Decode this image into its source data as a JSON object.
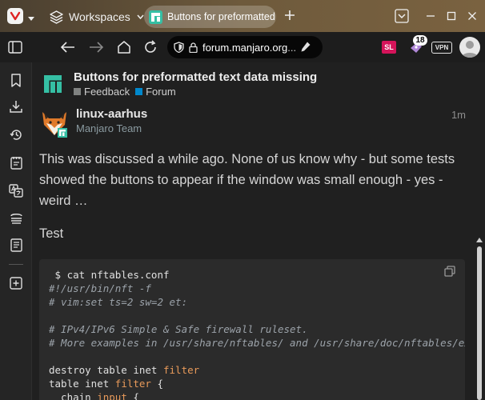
{
  "titlebar": {
    "workspaces_label": "Workspaces",
    "active_tab_title": "Buttons for preformatted text data missing",
    "new_tab_symbol": "+"
  },
  "addressbar": {
    "url_host": "forum.manjaro.org",
    "url_rest": "...",
    "extensions": {
      "sl_label": "SL",
      "badge_count": "18",
      "vpn_label": "VPN"
    }
  },
  "topic": {
    "title": "Buttons for preformatted text data missing",
    "categories": [
      {
        "name": "Feedback",
        "color": "#808281"
      },
      {
        "name": "Forum",
        "color": "#0088cc"
      }
    ]
  },
  "post": {
    "username": "linux-aarhus",
    "user_title": "Manjaro Team",
    "time": "1m",
    "paragraph": "This was discussed a while ago. None of us know why - but some tests showed the buttons to appear if the window was small enough - yes - weird …",
    "paragraph2": "Test",
    "code_lines": [
      {
        "text": " $ cat nftables.conf",
        "style": "plain"
      },
      {
        "text": "#!/usr/bin/nft -f",
        "style": "comment"
      },
      {
        "text": "# vim:set ts=2 sw=2 et:",
        "style": "comment"
      },
      {
        "text": "",
        "style": "plain"
      },
      {
        "text": "# IPv4/IPv6 Simple & Safe firewall ruleset.",
        "style": "comment"
      },
      {
        "text": "# More examples in /usr/share/nftables/ and /usr/share/doc/nftables/examples/",
        "style": "comment"
      },
      {
        "text": "",
        "style": "plain"
      },
      {
        "text": "destroy table inet ",
        "style": "plain",
        "kw": "filter"
      },
      {
        "text": "table inet ",
        "style": "plain",
        "kw": "filter",
        "tail": " {"
      },
      {
        "text": "  chain ",
        "style": "plain",
        "kw": "input",
        "tail": " {"
      }
    ]
  },
  "colors": {
    "accent": "#35bfa4",
    "keyword": "#e89a5a",
    "comment": "#9ca3aa"
  }
}
